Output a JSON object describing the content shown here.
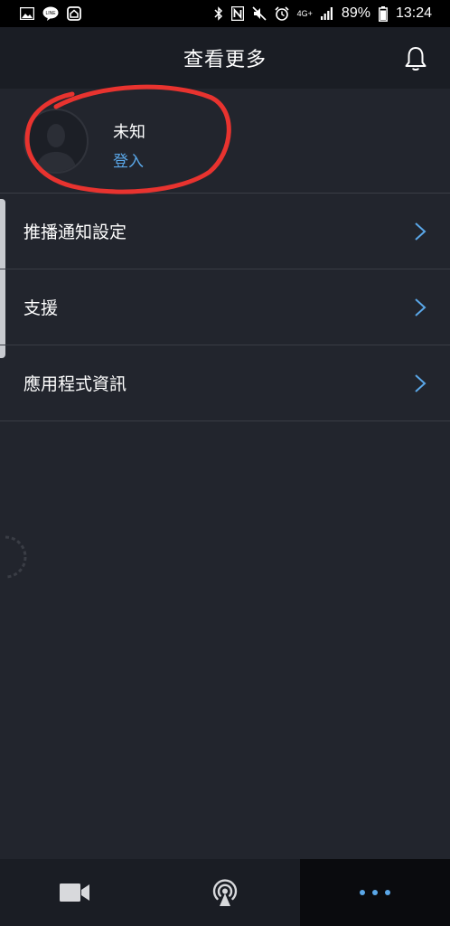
{
  "status_bar": {
    "time": "13:24",
    "battery": "89%",
    "network": "4G+",
    "left_icons": [
      "image-icon",
      "line-app-icon",
      "home-app-icon"
    ],
    "right_icons": [
      "bluetooth-icon",
      "nfc-icon",
      "mute-icon",
      "alarm-icon",
      "signal-icon",
      "battery-icon"
    ]
  },
  "header": {
    "title": "查看更多",
    "bell_icon": "bell-icon"
  },
  "profile": {
    "name": "未知",
    "login_label": "登入",
    "annotation_color": "#e8332f"
  },
  "menu": {
    "items": [
      {
        "label": "推播通知設定"
      },
      {
        "label": "支援"
      },
      {
        "label": "應用程式資訊"
      }
    ]
  },
  "bottom_nav": {
    "tabs": [
      {
        "icon": "video-camera-icon"
      },
      {
        "icon": "broadcast-icon"
      },
      {
        "icon": "more-dots-icon"
      }
    ]
  },
  "colors": {
    "background": "#22252d",
    "header": "#1a1d24",
    "accent": "#5aa7e8",
    "divider": "#3a3d45",
    "active_tab": "#0a0b0e"
  }
}
